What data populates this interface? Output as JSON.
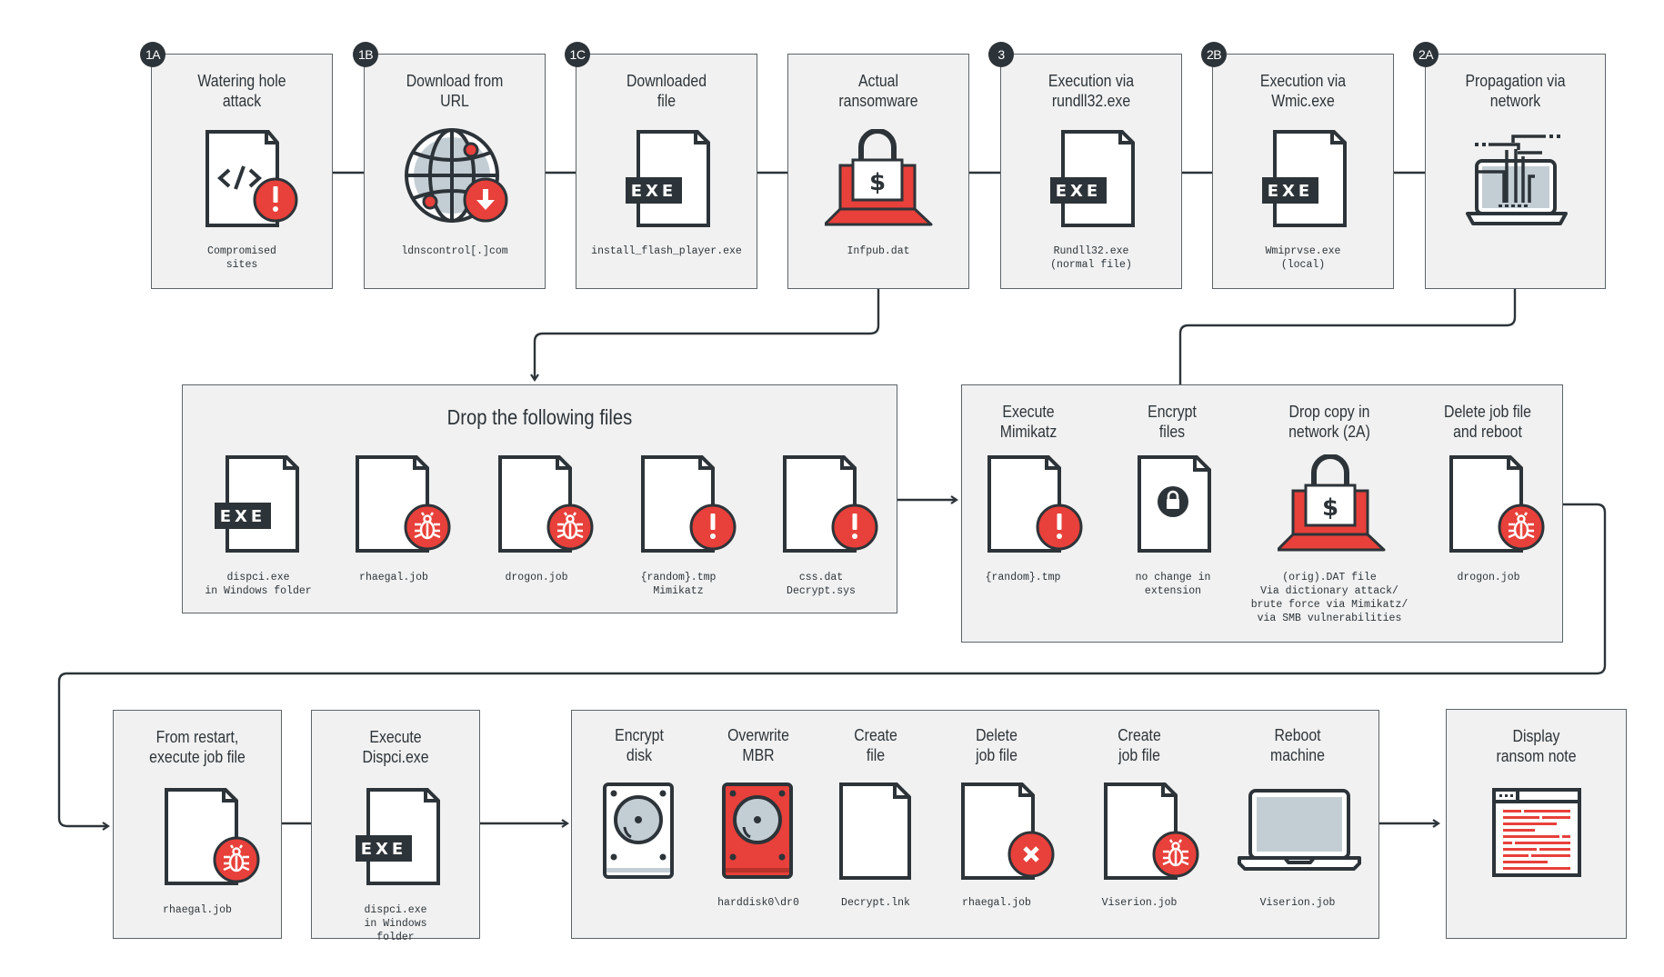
{
  "colors": {
    "dark": "#2d3439",
    "red": "#e8403a",
    "screen": "#c3ced4",
    "panel": "#f1f1f1"
  },
  "top_row": [
    {
      "badge": "1A",
      "title": "Watering hole\nattack",
      "icon": "code-file-warning-icon",
      "caption": "Compromised\nsites"
    },
    {
      "badge": "1B",
      "title": "Download from\nURL",
      "icon": "globe-download-icon",
      "caption": "ldnscontrol[.]com"
    },
    {
      "badge": "1C",
      "title": "Downloaded\nfile",
      "icon": "exe-file-icon",
      "caption": "install_flash_player.exe"
    },
    {
      "badge": "",
      "title": "Actual\nransomware",
      "icon": "ransom-laptop-icon",
      "caption": "Infpub.dat"
    },
    {
      "badge": "3",
      "title": "Execution via\nrundll32.exe",
      "icon": "exe-file-icon",
      "caption": "Rundll32.exe\n(normal file)"
    },
    {
      "badge": "2B",
      "title": "Execution via\nWmic.exe",
      "icon": "exe-file-icon",
      "caption": "Wmiprvse.exe\n(local)"
    },
    {
      "badge": "2A",
      "title": "Propagation via\nnetwork",
      "icon": "network-laptop-icon",
      "caption": ""
    }
  ],
  "drop_box": {
    "title": "Drop the following files",
    "files": [
      {
        "icon": "exe-file-icon",
        "caption": "dispci.exe\nin Windows folder"
      },
      {
        "icon": "bug-file-icon",
        "caption": "rhaegal.job"
      },
      {
        "icon": "bug-file-icon",
        "caption": "drogon.job"
      },
      {
        "icon": "warning-file-icon",
        "caption": "{random}.tmp\nMimikatz"
      },
      {
        "icon": "warning-file-icon",
        "caption": "css.dat\nDecrypt.sys"
      }
    ]
  },
  "actions_box": {
    "steps": [
      {
        "title": "Execute\nMimikatz",
        "icon": "warning-file-icon",
        "caption": "{random}.tmp"
      },
      {
        "title": "Encrypt\nfiles",
        "icon": "lock-file-icon",
        "caption": "no change in\nextension"
      },
      {
        "title": "Drop copy in\nnetwork (2A)",
        "icon": "ransom-laptop-icon",
        "caption": "(orig).DAT file\nVia dictionary attack/\nbrute force via Mimikatz/\nvia SMB vulnerabilities"
      },
      {
        "title": "Delete job file\nand reboot",
        "icon": "bug-file-icon",
        "caption": "drogon.job"
      }
    ]
  },
  "bottom_row": {
    "restart": {
      "title": "From restart,\nexecute job file",
      "icon": "bug-file-icon",
      "caption": "rhaegal.job"
    },
    "dispci": {
      "title": "Execute\nDispci.exe",
      "icon": "exe-file-icon",
      "caption": "dispci.exe\nin Windows folder"
    },
    "steps": [
      {
        "title": "Encrypt\ndisk",
        "icon": "hard-disk-icon",
        "caption": ""
      },
      {
        "title": "Overwrite\nMBR",
        "icon": "hard-disk-red-icon",
        "caption": "harddisk0\\dr0"
      },
      {
        "title": "Create\nfile",
        "icon": "blank-file-icon",
        "caption": "Decrypt.lnk"
      },
      {
        "title": "Delete\njob file",
        "icon": "delete-file-icon",
        "caption": "rhaegal.job"
      },
      {
        "title": "Create\njob file",
        "icon": "bug-file-icon",
        "caption": "Viserion.job"
      },
      {
        "title": "Reboot\nmachine",
        "icon": "laptop-icon",
        "caption": "Viserion.job"
      }
    ],
    "ransom_note": {
      "title": "Display\nransom note",
      "icon": "ransom-note-window-icon"
    }
  }
}
